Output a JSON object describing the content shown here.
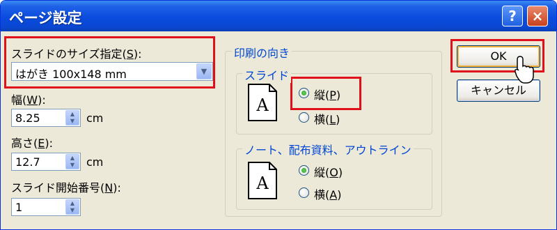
{
  "window": {
    "title": "ページ設定",
    "help_button": "?",
    "close_button": "×"
  },
  "slide_size": {
    "label": "スライドのサイズ指定(S):",
    "label_prefix": "スライドのサイズ指定(",
    "accel": "S",
    "label_suffix": "):",
    "selected": "はがき 100x148 mm"
  },
  "width": {
    "label_prefix": "幅(",
    "accel": "W",
    "label_suffix": "):",
    "value": "8.25",
    "unit": "cm"
  },
  "height": {
    "label_prefix": "高さ(",
    "accel": "E",
    "label_suffix": "):",
    "value": "12.7",
    "unit": "cm"
  },
  "start_number": {
    "label_prefix": "スライド開始番号(",
    "accel": "N",
    "label_suffix": "):",
    "value": "1"
  },
  "orientation": {
    "group_label": "印刷の向き",
    "slide": {
      "group_label": "スライド",
      "portrait": {
        "prefix": "縦(",
        "accel": "P",
        "suffix": ")",
        "checked": true
      },
      "landscape": {
        "prefix": "横(",
        "accel": "L",
        "suffix": ")",
        "checked": false
      }
    },
    "notes": {
      "group_label": "ノート、配布資料、アウトライン",
      "portrait": {
        "prefix": "縦(",
        "accel": "O",
        "suffix": ")",
        "checked": true
      },
      "landscape": {
        "prefix": "横(",
        "accel": "A",
        "suffix": ")",
        "checked": false
      }
    }
  },
  "buttons": {
    "ok": "OK",
    "cancel": "キャンセル"
  },
  "icons": {
    "page": "portrait-page-icon",
    "cursor": "mouse-pointer-icon",
    "spin": "spin-arrows-icon",
    "dropdown": "chevron-down-icon"
  },
  "colors": {
    "highlight": "#e0101a",
    "title_blue": "#0a4bde",
    "radio_green": "#21a121",
    "group_label": "#0046d5"
  }
}
